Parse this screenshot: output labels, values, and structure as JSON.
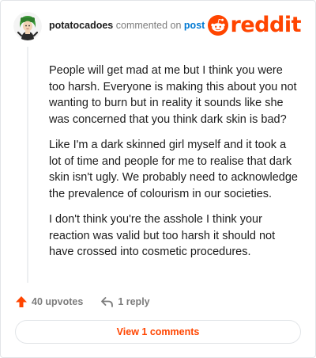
{
  "comment": {
    "username": "potatocadoes",
    "action_text": "commented on",
    "target_text": "post",
    "paragraphs": [
      "People will get mad at me but I think you were too harsh. Everyone is making this about you not wanting to burn but in reality it sounds like she was concerned that you think dark skin is bad?",
      "Like I'm a dark skinned girl myself and it took a lot of time and people for me to realise that dark skin isn't ugly. We probably need to acknowledge the prevalence of colourism in our societies.",
      "I don't think you're the asshole I think your reaction was valid but too harsh it should not have crossed into cosmetic procedures."
    ]
  },
  "brand": {
    "wordmark": "reddit",
    "color": "#ff4500"
  },
  "footer": {
    "upvotes_label": "40 upvotes",
    "upvote_icon": "upvote-arrow-icon",
    "replies_label": "1 reply",
    "reply_icon": "reply-arrow-icon",
    "view_comments_label": "View 1 comments"
  },
  "colors": {
    "accent": "#ff4500",
    "link": "#0079d3",
    "muted": "#7c7c7c",
    "text": "#1c1c1c"
  }
}
